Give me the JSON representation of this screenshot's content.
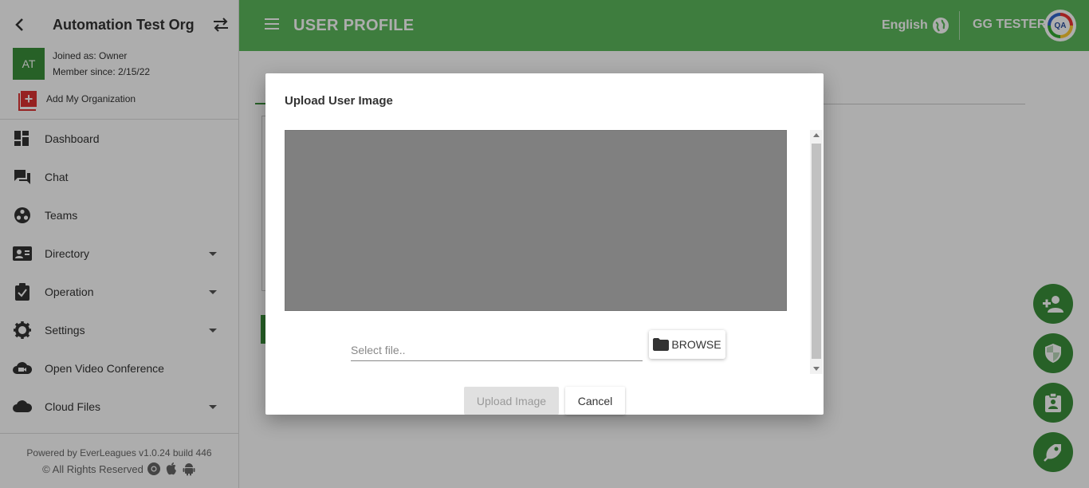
{
  "org": {
    "name": "Automation Test Org",
    "avatar_initials": "AT",
    "joined_as": "Joined as: Owner",
    "member_since": "Member since: 2/15/22",
    "add_org_label": "Add My Organization"
  },
  "nav": {
    "items": [
      {
        "label": "Dashboard",
        "icon": "dashboard-icon",
        "has_submenu": false
      },
      {
        "label": "Chat",
        "icon": "chat-icon",
        "has_submenu": false
      },
      {
        "label": "Teams",
        "icon": "teams-icon",
        "has_submenu": false
      },
      {
        "label": "Directory",
        "icon": "contact-card-icon",
        "has_submenu": true
      },
      {
        "label": "Operation",
        "icon": "clipboard-check-icon",
        "has_submenu": true
      },
      {
        "label": "Settings",
        "icon": "gear-icon",
        "has_submenu": true
      },
      {
        "label": "Open Video Conference",
        "icon": "video-cloud-icon",
        "has_submenu": false
      },
      {
        "label": "Cloud Files",
        "icon": "cloud-icon",
        "has_submenu": true
      }
    ]
  },
  "footer": {
    "powered_by": "Powered by EverLeagues v1.0.24 build 446",
    "rights": "© All Rights Reserved"
  },
  "topbar": {
    "title": "USER PROFILE",
    "language": "English",
    "user_name": "GG TESTER",
    "avatar_text": "QA",
    "color": "#5cb85c"
  },
  "modal": {
    "title": "Upload User Image",
    "file_placeholder": "Select file..",
    "browse_label": "BROWSE",
    "upload_label": "Upload Image",
    "cancel_label": "Cancel"
  },
  "fabs": [
    "add-person-icon",
    "shield-icon",
    "badge-icon",
    "rocket-icon"
  ],
  "colors": {
    "brand_green": "#3a8f3a",
    "preview_gray": "#808080"
  }
}
